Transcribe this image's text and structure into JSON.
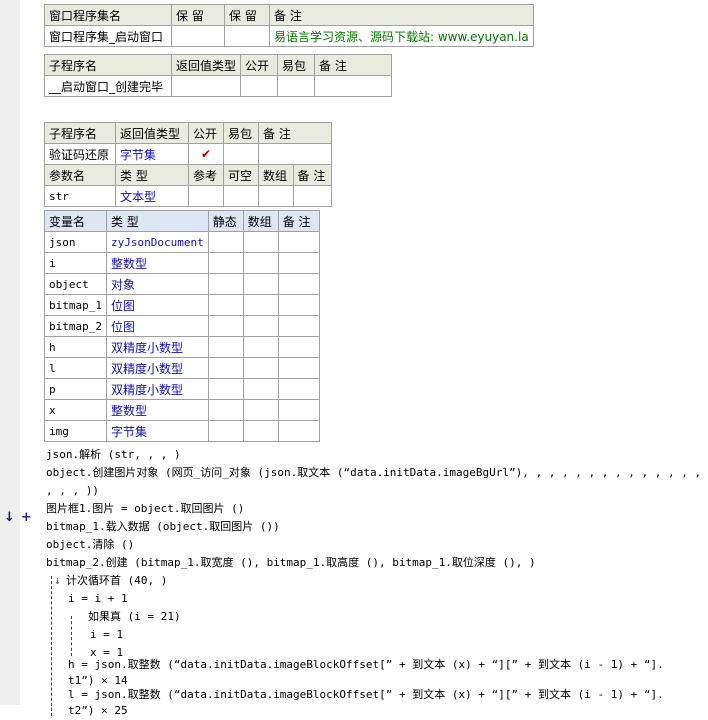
{
  "assembly_table": {
    "headers": [
      "窗口程序集名",
      "保 留",
      "保 留",
      "备 注"
    ],
    "row": [
      "窗口程序集_启动窗口",
      "",
      "",
      "易语言学习资源、源码下载站: www.eyuyan.la"
    ]
  },
  "sub1_table": {
    "headers": [
      "子程序名",
      "返回值类型",
      "公开",
      "易包",
      "备 注"
    ],
    "row": [
      "__启动窗口_创建完毕",
      "",
      "",
      "",
      ""
    ]
  },
  "sub2_table": {
    "headers": [
      "子程序名",
      "返回值类型",
      "公开",
      "易包",
      "备 注"
    ],
    "row": [
      "验证码还原",
      "字节集",
      "✔",
      "",
      ""
    ],
    "param_headers": [
      "参数名",
      "类 型",
      "参考",
      "可空",
      "数组",
      "备 注"
    ],
    "param_row": [
      "str",
      "文本型",
      "",
      "",
      "",
      ""
    ]
  },
  "var_table": {
    "headers": [
      "变量名",
      "类 型",
      "静态",
      "数组",
      "备 注"
    ],
    "rows": [
      [
        "json",
        "zyJsonDocument"
      ],
      [
        "i",
        "整数型"
      ],
      [
        "object",
        "对象"
      ],
      [
        "bitmap_1",
        "位图"
      ],
      [
        "bitmap_2",
        "位图"
      ],
      [
        "h",
        "双精度小数型"
      ],
      [
        "l",
        "双精度小数型"
      ],
      [
        "p",
        "双精度小数型"
      ],
      [
        "x",
        "整数型"
      ],
      [
        "img",
        "字节集"
      ]
    ]
  },
  "code": {
    "l1": "json.解析 (str, , , )",
    "l2": "object.创建图片对象 (网页_访问_对象 (json.取文本 (“data.initData.imageBgUrl”), , , , , , , , , , , , , , ,",
    "l3": ", , , ))",
    "l4": "图片框1.图片 = object.取回图片 ()",
    "l5": "bitmap_1.载入数据 (object.取回图片 ())",
    "l6": "object.清除 ()",
    "l7": "bitmap_2.创建 (bitmap_1.取宽度 (), bitmap_1.取高度 (), bitmap_1.取位深度 (), )",
    "l8": "计次循环首 (40, )",
    "l9": "i = i + 1",
    "l10": "如果真 (i = 21)",
    "l11": "i = 1",
    "l12": "x = 1",
    "l13": "h = json.取整数 (“data.initData.imageBlockOffset[” + 到文本 (x) + “][” + 到文本 (i - 1) + “].",
    "l14": "t1”) × 14",
    "l15": "l = json.取整数 (“data.initData.imageBlockOffset[” + 到文本 (x) + “][” + 到文本 (i - 1) + “].",
    "l16": "t2”) × 25"
  },
  "gutter": {
    "arrow": "↓",
    "plus": "+"
  }
}
